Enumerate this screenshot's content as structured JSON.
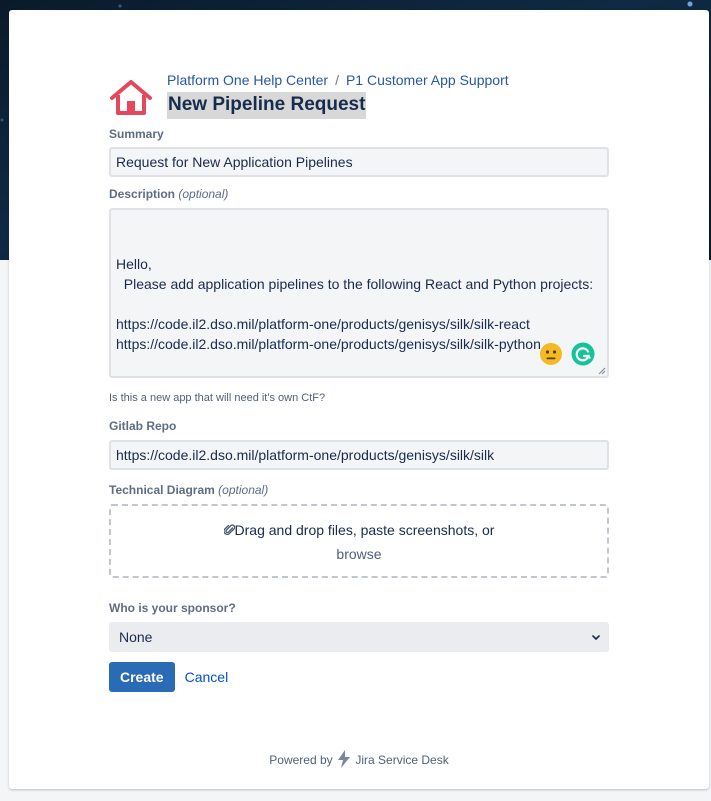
{
  "breadcrumb": {
    "home": "Platform One Help Center",
    "separator": "/",
    "project": "P1 Customer App Support"
  },
  "page_title": "New Pipeline Request",
  "summary": {
    "label": "Summary",
    "value": "Request for New Application Pipelines"
  },
  "description": {
    "label": "Description",
    "optional": "(optional)",
    "value": "Hello,\n  Please add application pipelines to the following React and Python projects:\n\nhttps://code.il2.dso.mil/platform-one/products/genisys/silk/silk-react\nhttps://code.il2.dso.mil/platform-one/products/genisys/silk/silk-python"
  },
  "ctf_question": "Is this a new app that will need it's own CtF?",
  "gitlab_repo": {
    "label": "Gitlab Repo",
    "value": "https://code.il2.dso.mil/platform-one/products/genisys/silk/silk"
  },
  "technical_diagram": {
    "label": "Technical Diagram",
    "optional": "(optional)",
    "drop_text": "Drag and drop files, paste screenshots, or",
    "browse": "browse"
  },
  "sponsor": {
    "label": "Who is your sponsor?",
    "selected": "None"
  },
  "actions": {
    "create": "Create",
    "cancel": "Cancel"
  },
  "footer": {
    "powered_by": "Powered by",
    "product": "Jira Service Desk"
  },
  "colors": {
    "home_icon": "#e5475d",
    "link": "#2458a6",
    "primary_button": "#2a6bb5",
    "grammarly": "#15c39a",
    "emoji": "#f5b921"
  },
  "icons": [
    "home-icon",
    "paperclip-icon",
    "neutral-face-emoji-icon",
    "grammarly-icon",
    "resize-handle-icon",
    "chevron-down-icon",
    "jira-logo-icon"
  ]
}
